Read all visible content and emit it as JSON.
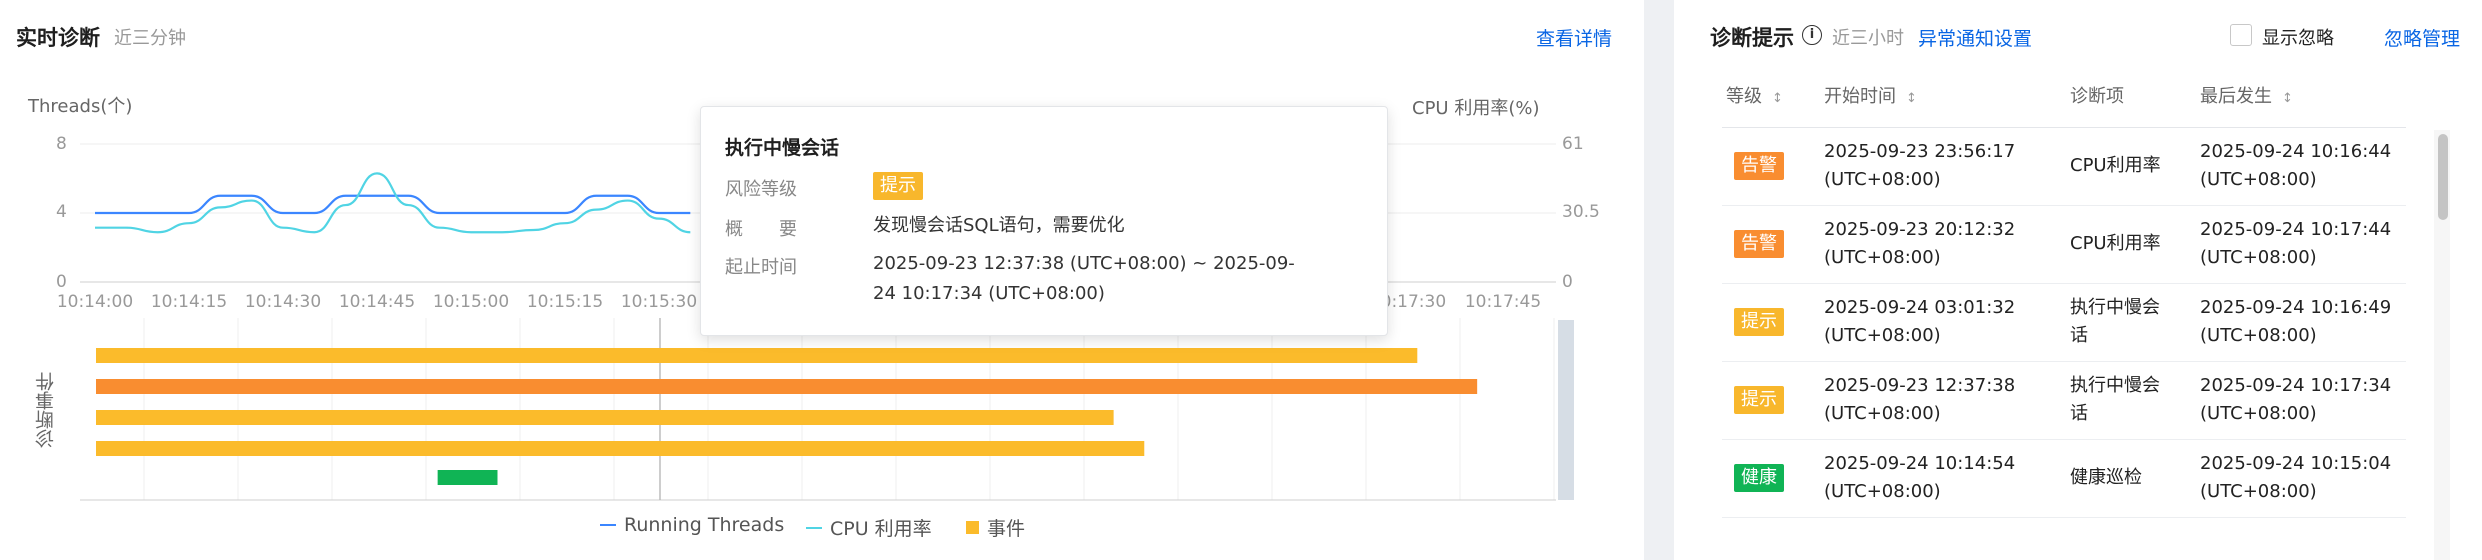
{
  "left": {
    "title": "实时诊断",
    "subtitle": "近三分钟",
    "detail_link": "查看详情",
    "y_left_title": "Threads(个)",
    "y_right_title": "CPU 利用率(%)",
    "y_left_ticks": [
      "8",
      "4",
      "0"
    ],
    "y_right_ticks": [
      "61",
      "30.5",
      "0"
    ],
    "x_ticks": [
      "10:14:00",
      "10:14:15",
      "10:14:30",
      "10:14:45",
      "10:15:00",
      "10:15:15",
      "10:15:30",
      "10:17:30",
      "10:17:45"
    ],
    "event_axis_label": "诊断事件",
    "legend": {
      "threads": "Running Threads",
      "cpu": "CPU 利用率",
      "events": "事件"
    },
    "colors": {
      "threads": "#3b86ff",
      "cpu": "#50d4e4",
      "event_tip": "#fbbb2b",
      "event_warn": "#f98d30",
      "event_health": "#10b455"
    }
  },
  "chart_data": {
    "type": "line",
    "x_label": "",
    "y_left_range": [
      0,
      8
    ],
    "y_right_range": [
      0,
      61
    ],
    "series": [
      {
        "name": "Running Threads",
        "axis": "left",
        "x": [
          "10:14:00",
          "10:14:05",
          "10:14:10",
          "10:14:15",
          "10:14:20",
          "10:14:25",
          "10:14:30",
          "10:14:35",
          "10:14:40",
          "10:14:45",
          "10:14:50",
          "10:14:55",
          "10:15:00",
          "10:15:05",
          "10:15:10",
          "10:15:15",
          "10:15:20",
          "10:15:25",
          "10:15:30",
          "10:15:35"
        ],
        "values": [
          4,
          4,
          4,
          4,
          5,
          5,
          4,
          4,
          5,
          5,
          5,
          4,
          4,
          4,
          4,
          4,
          5,
          5,
          4,
          4
        ]
      },
      {
        "name": "CPU 利用率",
        "axis": "right",
        "x": [
          "10:14:00",
          "10:14:05",
          "10:14:10",
          "10:14:15",
          "10:14:20",
          "10:14:25",
          "10:14:30",
          "10:14:35",
          "10:14:40",
          "10:14:45",
          "10:14:50",
          "10:14:55",
          "10:15:00",
          "10:15:05",
          "10:15:10",
          "10:15:15",
          "10:15:20",
          "10:15:25",
          "10:15:30",
          "10:15:35"
        ],
        "values": [
          24,
          24,
          22,
          26,
          33,
          36,
          24,
          22,
          34,
          48,
          34,
          24,
          22,
          22,
          23,
          26,
          32,
          36,
          28,
          22
        ]
      }
    ],
    "events": [
      {
        "level": "提示",
        "start": 0.0,
        "end": 0.905
      },
      {
        "level": "告警",
        "start": 0.0,
        "end": 0.946
      },
      {
        "level": "提示",
        "start": 0.0,
        "end": 0.697
      },
      {
        "level": "提示",
        "start": 0.0,
        "end": 0.718
      },
      {
        "level": "健康",
        "start": 0.234,
        "end": 0.275
      }
    ]
  },
  "tooltip": {
    "title": "执行中慢会话",
    "risk_label": "风险等级",
    "risk_value": "提示",
    "summary_label": "概　　要",
    "summary_value": "发现慢会话SQL语句，需要优化",
    "time_label": "起止时间",
    "time_value": "2025-09-23 12:37:38 (UTC+08:00) ~ 2025-09-24 10:17:34 (UTC+08:00)"
  },
  "right": {
    "title": "诊断提示",
    "subtitle": "近三小时",
    "notify_link": "异常通知设置",
    "show_ignored": "显示忽略",
    "ignore_manage": "忽略管理",
    "columns": [
      "等级",
      "开始时间",
      "诊断项",
      "最后发生"
    ],
    "rows": [
      {
        "level": "告警",
        "level_type": "warn",
        "start": "2025-09-23 23:56:17\n(UTC+08:00)",
        "item": "CPU利用率",
        "last": "2025-09-24 10:16:44\n(UTC+08:00)"
      },
      {
        "level": "告警",
        "level_type": "warn",
        "start": "2025-09-23 20:12:32\n(UTC+08:00)",
        "item": "CPU利用率",
        "last": "2025-09-24 10:17:44\n(UTC+08:00)"
      },
      {
        "level": "提示",
        "level_type": "tip",
        "start": "2025-09-24 03:01:32\n(UTC+08:00)",
        "item": "执行中慢会\n话",
        "last": "2025-09-24 10:16:49\n(UTC+08:00)"
      },
      {
        "level": "提示",
        "level_type": "tip",
        "start": "2025-09-23 12:37:38\n(UTC+08:00)",
        "item": "执行中慢会\n话",
        "last": "2025-09-24 10:17:34\n(UTC+08:00)"
      },
      {
        "level": "健康",
        "level_type": "health",
        "start": "2025-09-24 10:14:54\n(UTC+08:00)",
        "item": "健康巡检",
        "last": "2025-09-24 10:15:04\n(UTC+08:00)"
      }
    ]
  }
}
